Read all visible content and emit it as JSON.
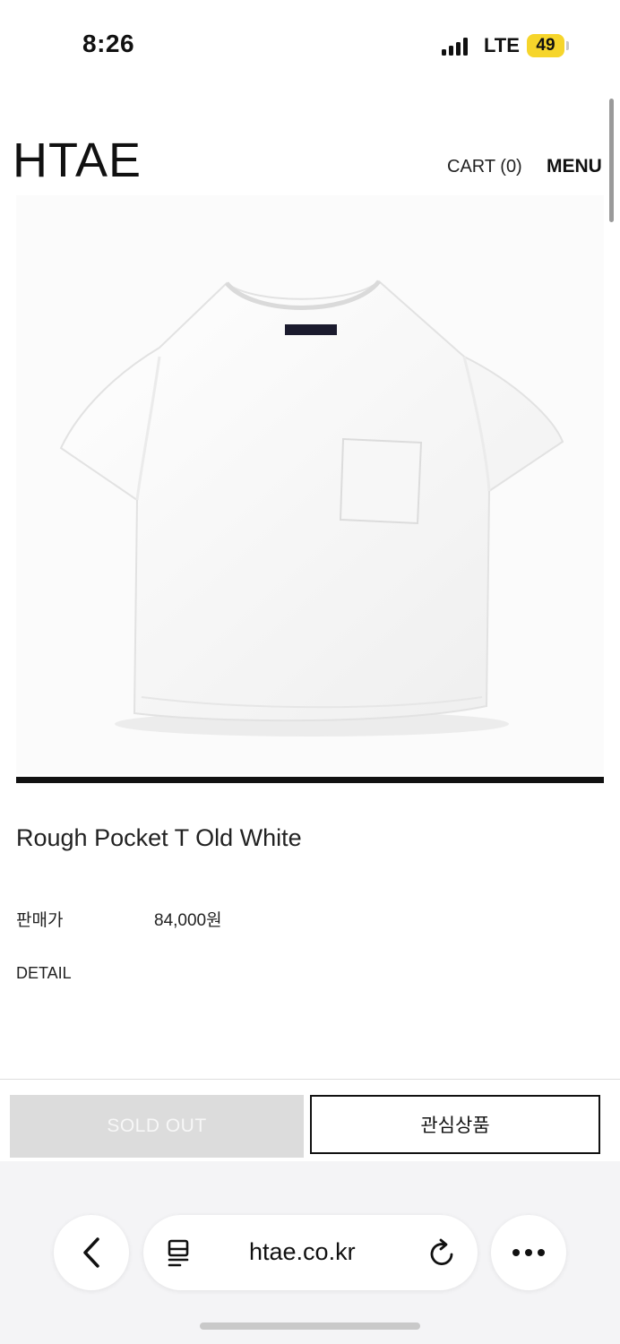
{
  "status_bar": {
    "time": "8:26",
    "network": "LTE",
    "battery": "49"
  },
  "header": {
    "logo": "HTAE",
    "cart": "CART (0)",
    "menu": "MENU"
  },
  "product": {
    "image_icon": "white-pocket-tshirt-photo",
    "name": "Rough Pocket T Old White",
    "price_label": "판매가",
    "price_value": "84,000원",
    "detail_label": "DETAIL"
  },
  "actions": {
    "sold_out": "SOLD OUT",
    "wishlist": "관심상품"
  },
  "browser": {
    "url": "htae.co.kr",
    "back_icon": "chevron-left-icon",
    "reader_icon": "reader-icon",
    "reload_icon": "reload-icon",
    "more_icon": "ellipsis-icon"
  },
  "colors": {
    "battery": "#f6d52b",
    "sold_out_bg": "#dcdcdc",
    "text": "#111111"
  }
}
